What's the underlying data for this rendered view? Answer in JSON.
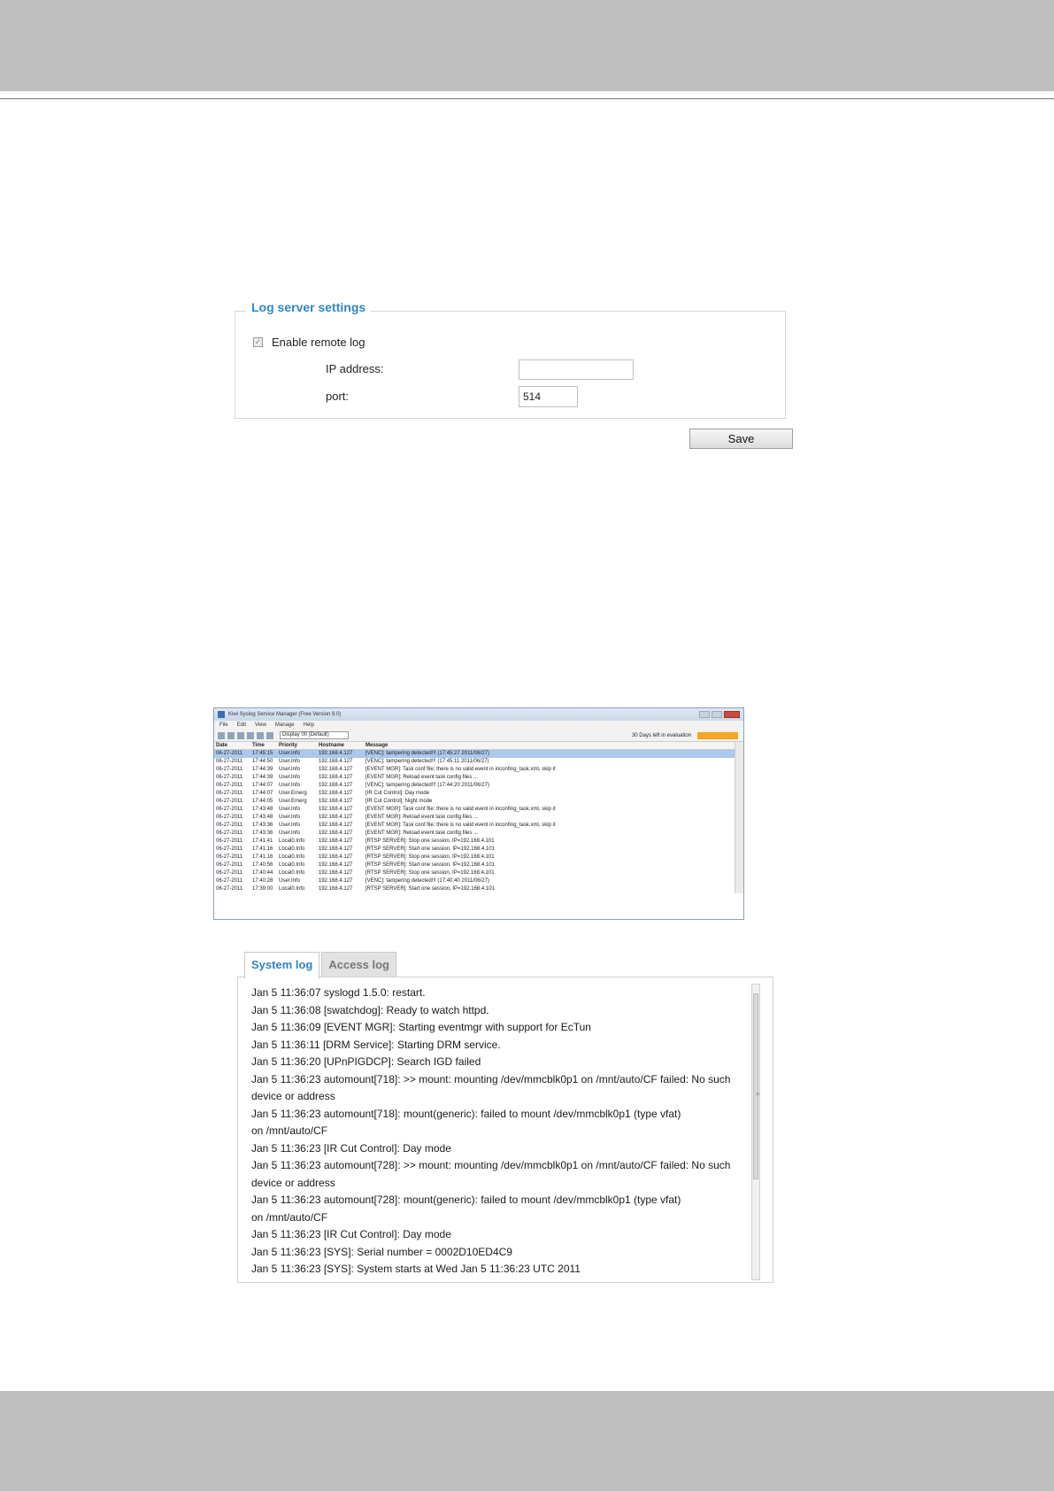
{
  "log_server": {
    "title": "Log server settings",
    "enable_label": "Enable remote log",
    "ip_label": "IP address:",
    "ip_value": "",
    "port_label": "port:",
    "port_value": "514",
    "save_label": "Save"
  },
  "viewer": {
    "title": "Kiwi Syslog Service Manager (Free Version 9.0)",
    "menu": [
      "File",
      "Edit",
      "View",
      "Manage",
      "Help"
    ],
    "display_select": "Display 00 (Default)",
    "trial_text": "30 Days left in evaluation",
    "columns": [
      "Date",
      "Time",
      "Priority",
      "Hostname",
      "Message"
    ],
    "rows": [
      {
        "date": "06-27-2011",
        "time": "17:45:15",
        "priority": "User.Info",
        "host": "192.168.4.127",
        "message": "[VENC]: tampering detected!!! (17:45:27 2011/06/27)"
      },
      {
        "date": "06-27-2011",
        "time": "17:44:50",
        "priority": "User.Info",
        "host": "192.168.4.127",
        "message": "[VENC]: tampering detected!!! (17:45:11 2011/06/27)"
      },
      {
        "date": "06-27-2011",
        "time": "17:44:39",
        "priority": "User.Info",
        "host": "192.168.4.127",
        "message": "[EVENT MGR]: Task conf file: there is no valid event in inconfing_task.xml, skip it"
      },
      {
        "date": "06-27-2011",
        "time": "17:44:39",
        "priority": "User.Info",
        "host": "192.168.4.127",
        "message": "[EVENT MGR]: Reload event task config files ..."
      },
      {
        "date": "06-27-2011",
        "time": "17:44:07",
        "priority": "User.Info",
        "host": "192.168.4.127",
        "message": "[VENC]: tampering detected!!! (17:44:20 2011/06/27)"
      },
      {
        "date": "06-27-2011",
        "time": "17:44:07",
        "priority": "User.Emerg",
        "host": "192.168.4.127",
        "message": "[IR Cut Control]: Day mode"
      },
      {
        "date": "06-27-2011",
        "time": "17:44:05",
        "priority": "User.Emerg",
        "host": "192.168.4.127",
        "message": "[IR Cut Control]: Night mode"
      },
      {
        "date": "06-27-2011",
        "time": "17:43:48",
        "priority": "User.Info",
        "host": "192.168.4.127",
        "message": "[EVENT MGR]: Task conf file: there is no valid event in inconfing_task.xml, skip it"
      },
      {
        "date": "06-27-2011",
        "time": "17:43:48",
        "priority": "User.Info",
        "host": "192.168.4.127",
        "message": "[EVENT MGR]: Reload event task config files ..."
      },
      {
        "date": "06-27-2011",
        "time": "17:43:36",
        "priority": "User.Info",
        "host": "192.168.4.127",
        "message": "[EVENT MGR]: Task conf file: there is no valid event in inconfing_task.xml, skip it"
      },
      {
        "date": "06-27-2011",
        "time": "17:43:36",
        "priority": "User.Info",
        "host": "192.168.4.127",
        "message": "[EVENT MGR]: Reload event task config files ..."
      },
      {
        "date": "06-27-2011",
        "time": "17:41:41",
        "priority": "Local0.Info",
        "host": "192.168.4.127",
        "message": "[RTSP SERVER]: Stop one session, IP=192.168.4.101"
      },
      {
        "date": "06-27-2011",
        "time": "17:41:16",
        "priority": "Local0.Info",
        "host": "192.168.4.127",
        "message": "[RTSP SERVER]: Start one session, IP=192.168.4.101"
      },
      {
        "date": "06-27-2011",
        "time": "17:41:16",
        "priority": "Local0.Info",
        "host": "192.168.4.127",
        "message": "[RTSP SERVER]: Stop one session, IP=192.168.4.101"
      },
      {
        "date": "06-27-2011",
        "time": "17:40:56",
        "priority": "Local0.Info",
        "host": "192.168.4.127",
        "message": "[RTSP SERVER]: Start one session, IP=192.168.4.101"
      },
      {
        "date": "06-27-2011",
        "time": "17:40:44",
        "priority": "Local0.Info",
        "host": "192.168.4.127",
        "message": "[RTSP SERVER]: Stop one session, IP=192.168.4.101"
      },
      {
        "date": "06-27-2011",
        "time": "17:40:28",
        "priority": "User.Info",
        "host": "192.168.4.127",
        "message": "[VENC]: tampering detected!!! (17:40:40 2011/06/27)"
      },
      {
        "date": "06-27-2011",
        "time": "17:39:00",
        "priority": "Local0.Info",
        "host": "192.168.4.127",
        "message": "[RTSP SERVER]: Start one session, IP=192.168.4.101"
      }
    ]
  },
  "syslog": {
    "tabs": [
      "System log",
      "Access log"
    ],
    "lines": [
      "Jan 5 11:36:07 syslogd 1.5.0: restart.",
      "Jan 5 11:36:08 [swatchdog]: Ready to watch httpd.",
      "Jan 5 11:36:09 [EVENT MGR]: Starting eventmgr with support for EcTun",
      "Jan 5 11:36:11 [DRM Service]: Starting DRM service.",
      "Jan 5 11:36:20 [UPnPIGDCP]: Search IGD failed",
      "Jan 5 11:36:23 automount[718]: >> mount: mounting /dev/mmcblk0p1 on /mnt/auto/CF failed: No such",
      "device or address",
      "Jan 5 11:36:23 automount[718]: mount(generic): failed to mount /dev/mmcblk0p1 (type vfat)",
      "on /mnt/auto/CF",
      "Jan 5 11:36:23 [IR Cut Control]: Day mode",
      "Jan 5 11:36:23 automount[728]: >> mount: mounting /dev/mmcblk0p1 on /mnt/auto/CF failed: No such",
      "device or address",
      "Jan 5 11:36:23 automount[728]: mount(generic): failed to mount /dev/mmcblk0p1 (type vfat)",
      "on /mnt/auto/CF",
      "Jan 5 11:36:23 [IR Cut Control]: Day mode",
      "Jan 5 11:36:23 [SYS]: Serial number = 0002D10ED4C9",
      "Jan 5 11:36:23 [SYS]: System starts at Wed Jan 5 11:36:23 UTC 2011"
    ]
  }
}
